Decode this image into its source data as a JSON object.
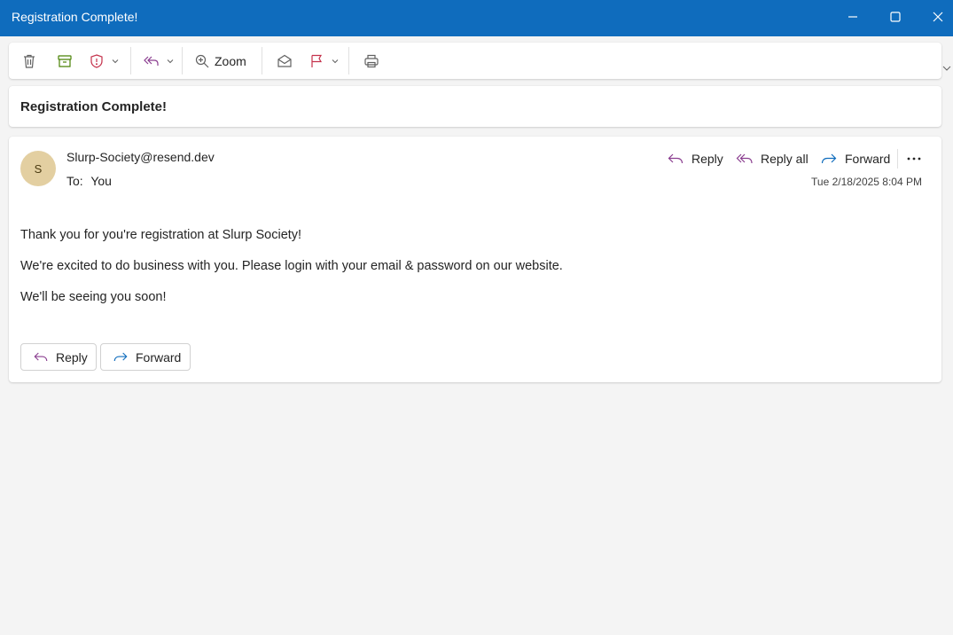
{
  "window": {
    "title": "Registration Complete!",
    "controls": [
      "minimize-icon",
      "maximize-icon",
      "close-icon"
    ]
  },
  "toolbar": {
    "items": [
      "delete-icon",
      "archive-icon",
      "report-icon",
      "reply-all-icon",
      "zoom-icon",
      "mark-read-icon",
      "flag-icon",
      "print-icon"
    ],
    "zoom_label": "Zoom"
  },
  "message": {
    "subject": "Registration Complete!",
    "avatar_initial": "S",
    "sender": "Slurp-Society@resend.dev",
    "to_label": "To:",
    "to_value": "You",
    "date": "Tue 2/18/2025 8:04 PM",
    "actions": {
      "reply": "Reply",
      "reply_all": "Reply all",
      "forward": "Forward"
    },
    "body": [
      "Thank you for you're registration at Slurp Society!",
      "We're excited to do business with you. Please login with your email & password on our website.",
      "We'll be seeing you soon!"
    ],
    "footer": {
      "reply": "Reply",
      "forward": "Forward"
    }
  },
  "colors": {
    "titlebar": "#0f6cbd",
    "reply_accent": "#8a3d8f",
    "forward_accent": "#0f6cbd",
    "report_accent": "#c4314b",
    "flag_accent": "#c4314b",
    "archive_accent": "#498205",
    "avatar_bg": "#e3cfa1"
  }
}
